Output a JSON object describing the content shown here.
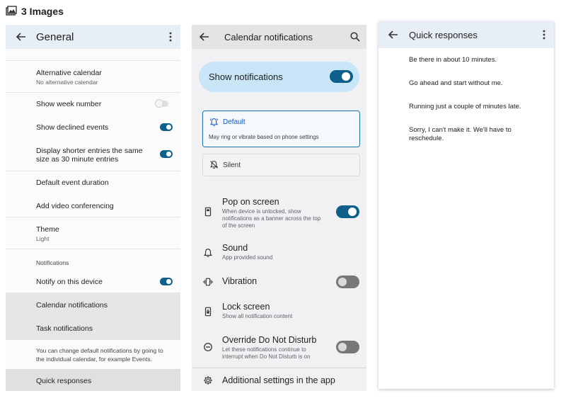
{
  "header": {
    "title": "3 Images",
    "icon": "images-icon"
  },
  "general": {
    "title": "General",
    "items": {
      "alt_calendar": {
        "label": "Alternative calendar",
        "sub": "No alternative calendar"
      },
      "week_number": {
        "label": "Show week number",
        "on": false
      },
      "declined": {
        "label": "Show declined events",
        "on": true
      },
      "shorter": {
        "label": "Display shorter entries the same",
        "label2": "size as 30 minute entries",
        "on": true
      },
      "duration": {
        "label": "Default event duration"
      },
      "video": {
        "label": "Add video conferencing"
      },
      "theme": {
        "label": "Theme",
        "sub": "Light"
      },
      "notif_header": "Notifications",
      "notify_device": {
        "label": "Notify on this device",
        "on": true
      },
      "calendar_notifications": {
        "label": "Calendar notifications"
      },
      "task_notifications": {
        "label": "Task notifications"
      },
      "info_line1": "You can change default notifications by going to",
      "info_line2": "the individual calendar, for example Events.",
      "quick_responses": {
        "label": "Quick responses"
      }
    }
  },
  "calendar_notifications": {
    "title": "Calendar notifications",
    "show_notifications": {
      "label": "Show notifications",
      "on": true
    },
    "default": {
      "label": "Default",
      "sub": "May ring or vibrate based on phone settings"
    },
    "silent": {
      "label": "Silent"
    },
    "pop_on_screen": {
      "label": "Pop on screen",
      "sub1": "When device is unlocked, show",
      "sub2": "notifications as a banner across the top",
      "sub3": "of the screen",
      "on": true
    },
    "sound": {
      "label": "Sound",
      "sub": "App provided sound"
    },
    "vibration": {
      "label": "Vibration",
      "on": false
    },
    "lock_screen": {
      "label": "Lock screen",
      "sub": "Show all notification content"
    },
    "override_dnd": {
      "label": "Override Do Not Disturb",
      "sub1": "Let these notifications continue to",
      "sub2": "interrupt when Do Not Disturb is on",
      "on": false
    },
    "additional": {
      "label": "Additional settings in the app"
    }
  },
  "quick_responses": {
    "title": "Quick responses",
    "responses": [
      "Be there in about 10 minutes.",
      "Go ahead and start without me.",
      "Running just a couple of minutes late.",
      "Sorry, I can't make it. We'll have to reschedule."
    ]
  },
  "colors": {
    "accent": "#0e5f8a",
    "banner": "#c8e6f7",
    "topbar": "#e8eef6"
  }
}
